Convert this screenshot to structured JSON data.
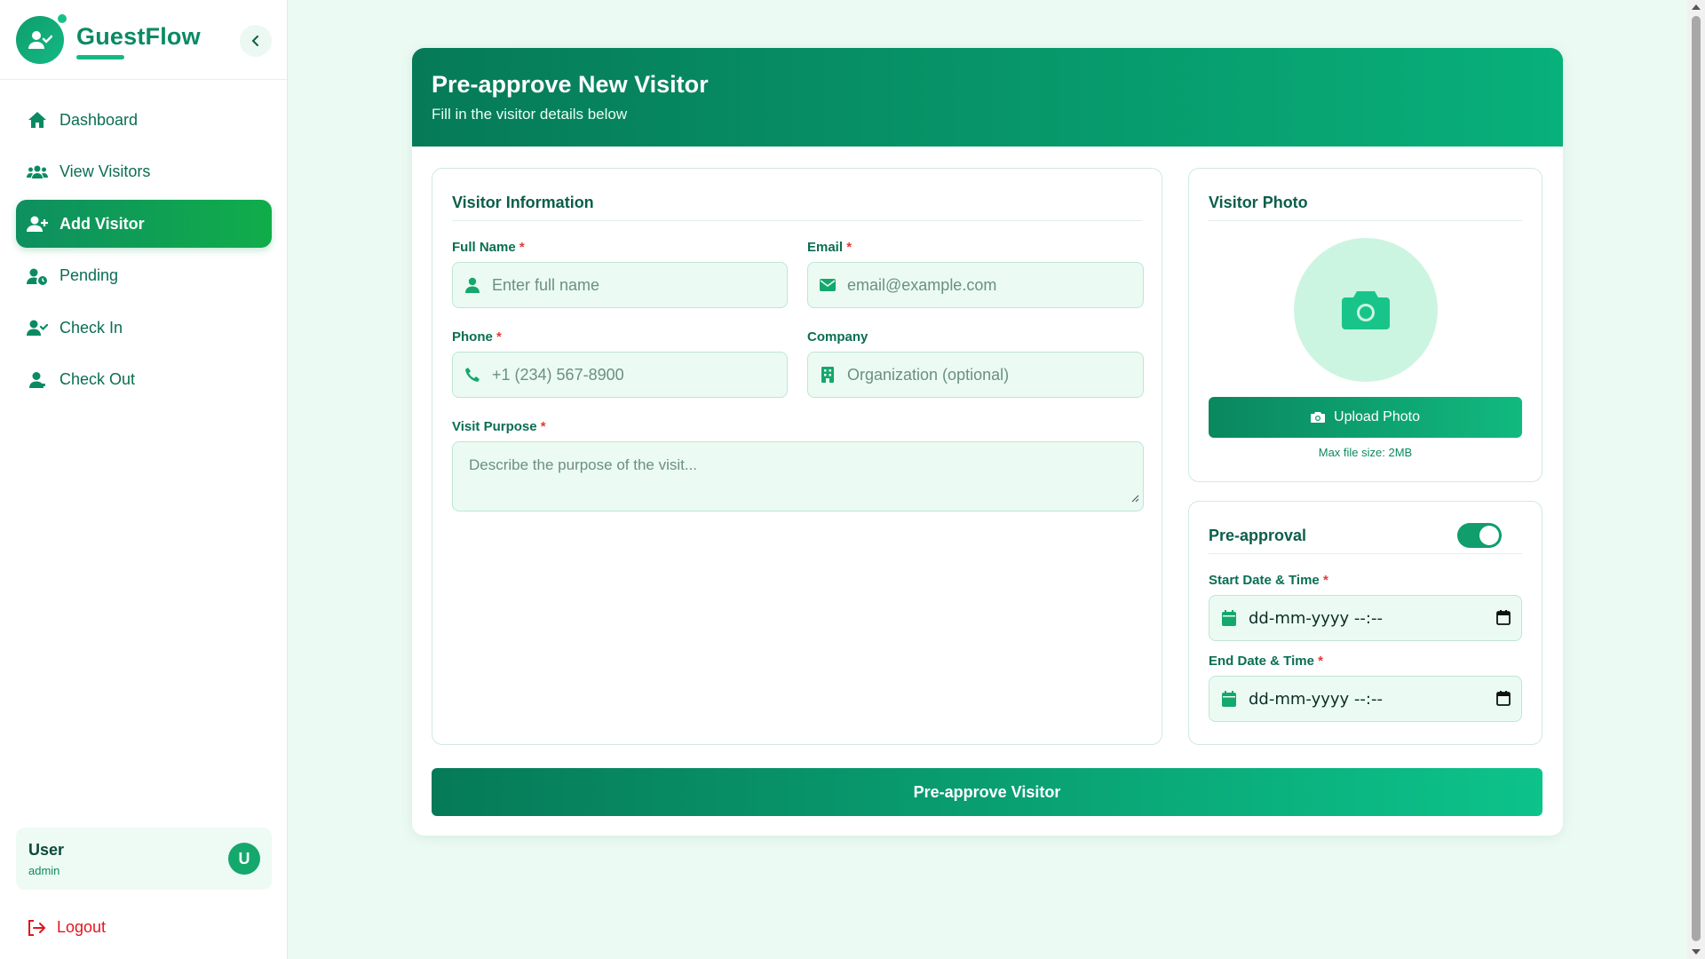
{
  "brand": {
    "name": "GuestFlow"
  },
  "nav": [
    {
      "label": "Dashboard",
      "icon": "home-icon"
    },
    {
      "label": "View Visitors",
      "icon": "users-icon"
    },
    {
      "label": "Add Visitor",
      "icon": "user-plus-icon",
      "active": true
    },
    {
      "label": "Pending",
      "icon": "user-clock-icon"
    },
    {
      "label": "Check In",
      "icon": "user-check-icon"
    },
    {
      "label": "Check Out",
      "icon": "user-minus-icon"
    }
  ],
  "user": {
    "name": "User",
    "role": "admin",
    "initial": "U"
  },
  "logout_label": "Logout",
  "header": {
    "title": "Pre-approve New Visitor",
    "subtitle": "Fill in the visitor details below"
  },
  "visitor_info": {
    "title": "Visitor Information",
    "full_name": {
      "label": "Full Name",
      "placeholder": "Enter full name",
      "required": "*"
    },
    "email": {
      "label": "Email",
      "placeholder": "email@example.com",
      "required": "*"
    },
    "phone": {
      "label": "Phone",
      "placeholder": "+1 (234) 567-8900",
      "required": "*"
    },
    "company": {
      "label": "Company",
      "placeholder": "Organization (optional)"
    },
    "purpose": {
      "label": "Visit Purpose",
      "placeholder": "Describe the purpose of the visit...",
      "required": "*"
    }
  },
  "photo": {
    "title": "Visitor Photo",
    "upload_label": "Upload Photo",
    "max_size": "Max file size: 2MB"
  },
  "preapproval": {
    "title": "Pre-approval",
    "enabled": true,
    "start": {
      "label": "Start Date & Time",
      "value": "dd-mm-yyyy --:--",
      "required": "*"
    },
    "end": {
      "label": "End Date & Time",
      "value": "dd-mm-yyyy --:--",
      "required": "*"
    }
  },
  "submit_label": "Pre-approve Visitor",
  "colors": {
    "primary": "#0a8a63",
    "accent": "#14b884",
    "danger": "#e0161e",
    "field_bg": "#ebfbf3"
  }
}
